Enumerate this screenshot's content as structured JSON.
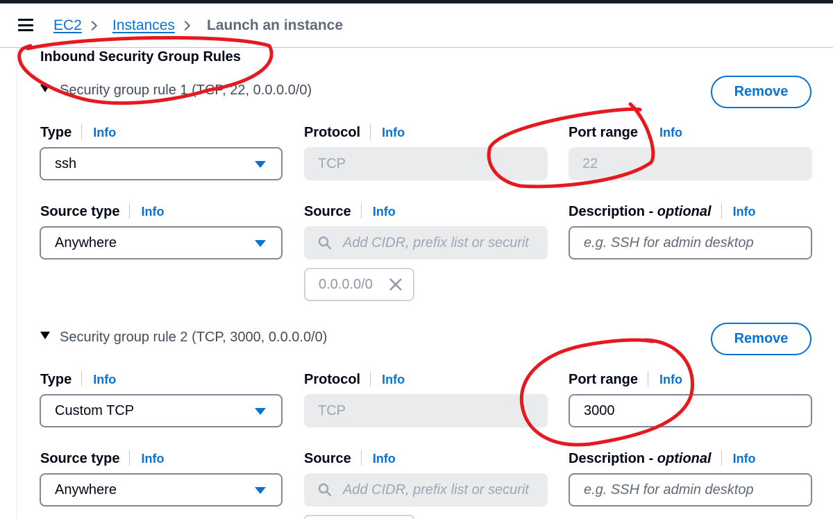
{
  "breadcrumb": {
    "items": [
      "EC2",
      "Instances"
    ],
    "current": "Launch an instance"
  },
  "section": {
    "title": "Inbound Security Group Rules"
  },
  "labels": {
    "type": "Type",
    "protocol": "Protocol",
    "port_range": "Port range",
    "source_type": "Source type",
    "source": "Source",
    "description_prefix": "Description - ",
    "description_optional": "optional",
    "info": "Info",
    "remove": "Remove"
  },
  "rules": [
    {
      "header": "Security group rule 1 (TCP, 22, 0.0.0.0/0)",
      "type": "ssh",
      "protocol": "TCP",
      "port_range": "22",
      "source_type": "Anywhere",
      "source_placeholder": "Add CIDR, prefix list or securit",
      "source_token": "0.0.0.0/0",
      "description_placeholder": "e.g. SSH for admin desktop"
    },
    {
      "header": "Security group rule 2 (TCP, 3000, 0.0.0.0/0)",
      "type": "Custom TCP",
      "protocol": "TCP",
      "port_range": "3000",
      "source_type": "Anywhere",
      "source_placeholder": "Add CIDR, prefix list or securit",
      "description_placeholder": "e.g. SSH for admin desktop"
    }
  ],
  "icons": {
    "menu": "hamburger-menu-icon",
    "separator": "chevron-right-icon",
    "expand": "caret-down-icon",
    "dropdown": "caret-down-icon",
    "search": "search-icon",
    "remove_token": "close-icon"
  },
  "colors": {
    "link": "#0972d3",
    "annotation": "#e5191e",
    "disabled_bg": "#e9ebed"
  }
}
